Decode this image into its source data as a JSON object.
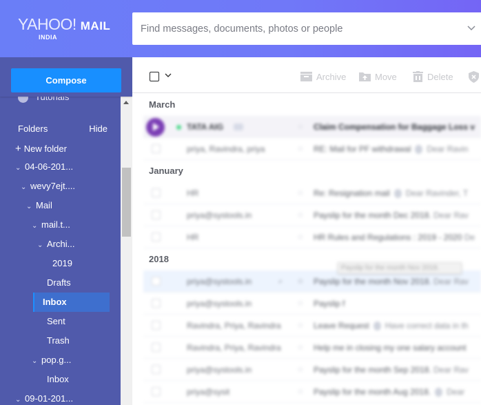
{
  "header": {
    "logo": {
      "brand": "YAHOO!",
      "product": "MAIL",
      "region": "INDIA"
    },
    "search": {
      "placeholder": "Find messages, documents, photos or people",
      "value": ""
    }
  },
  "sidebar": {
    "compose_label": "Compose",
    "tutorials_label": "Tutorials",
    "folders_label": "Folders",
    "hide_label": "Hide",
    "new_folder_label": "New folder",
    "tree": [
      {
        "label": "04-06-201...",
        "level": 0,
        "expanded": true
      },
      {
        "label": "wevy7ejt....",
        "level": 1,
        "expanded": true
      },
      {
        "label": "Mail",
        "level": 2,
        "expanded": true
      },
      {
        "label": "mail.t...",
        "level": 3,
        "expanded": true
      },
      {
        "label": "Archi...",
        "level": 4,
        "expanded": true
      },
      {
        "label": "2019",
        "level": 5
      },
      {
        "label": "Drafts",
        "level": 4
      },
      {
        "label": "Inbox",
        "level": 4,
        "active": true
      },
      {
        "label": "Sent",
        "level": 4
      },
      {
        "label": "Trash",
        "level": 4
      },
      {
        "label": "pop.g...",
        "level": 3,
        "expanded": true
      },
      {
        "label": "Inbox",
        "level": 4
      },
      {
        "label": "09-01-201...",
        "level": 0,
        "expanded": true
      }
    ]
  },
  "toolbar": {
    "archive_label": "Archive",
    "move_label": "Move",
    "delete_label": "Delete"
  },
  "messages": {
    "groups": [
      {
        "label": "March",
        "rows": [
          {
            "from": "TATA AIG",
            "subject": "Claim Compensation for Baggage Loss v",
            "snippet": "",
            "unread": true
          },
          {
            "from": "priya, Ravindra, priya",
            "subject": "RE: Mail for PF withdrawal",
            "snippet": "Dear Ravin",
            "attachment": true
          }
        ]
      },
      {
        "label": "January",
        "rows": [
          {
            "from": "HR",
            "subject": "Re: Resignation mail",
            "snippet": "Dear Ravinder, T",
            "attachment": true
          },
          {
            "from": "priya@systools.in",
            "subject": "Payslip for the month Dec 2018.",
            "snippet": "Dear Rav"
          },
          {
            "from": "HR",
            "subject": "HR Rules and Regulations : 2019 - 2020",
            "snippet": "De"
          }
        ]
      },
      {
        "label": "2018",
        "rows": [
          {
            "from": "priya@systools.in",
            "subject": "Payslip for the month Nov 2018.",
            "snippet": "Dear Rav",
            "hover": true
          },
          {
            "from": "priya@systools.in",
            "subject": "Payslip f",
            "snippet": "",
            "tooltip": "Payslip for the month Nov 2018."
          },
          {
            "from": "Ravindra, Priya, Ravindra",
            "subject": "Leave Request",
            "snippet": "Have correct data in th",
            "attachment": true
          },
          {
            "from": "Ravindra, Priya, Ravindra",
            "subject": "Help me in closing my one salary account",
            "snippet": ""
          },
          {
            "from": "priya@systools.in",
            "subject": "Payslip for the month Sep 2018.",
            "snippet": "Dear Rav"
          },
          {
            "from": "priya@sysit",
            "subject": "Payslip for the month Aug 2018.",
            "snippet": "Dear",
            "attachment": true
          }
        ]
      }
    ],
    "tooltip": "Payslip for the month Nov 2018."
  },
  "colors": {
    "header_start": "#6a7ef7",
    "header_end": "#7465f5",
    "sidebar": "#505aab",
    "compose": "#188fff",
    "active_folder": "#3e6fce"
  }
}
